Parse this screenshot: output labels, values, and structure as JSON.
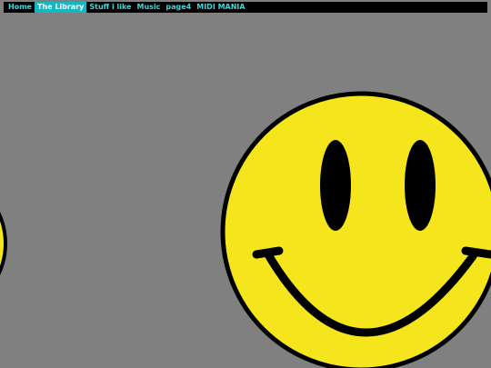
{
  "nav": {
    "items": [
      {
        "label": "Home"
      },
      {
        "label": "The Library",
        "active": true
      },
      {
        "label": "Stuff i like"
      },
      {
        "label": "Music"
      },
      {
        "label": "page4"
      },
      {
        "label": "MIDI MANIA"
      }
    ]
  },
  "colors": {
    "background": "#808080",
    "navbar": "#000000",
    "nav_text": "#3fd6dc",
    "nav_active_bg": "#14b7c4",
    "smiley_face": "#f4e51c",
    "smiley_outline": "#000000"
  },
  "images": [
    {
      "name": "smiley-face",
      "description_icon": "smiley-face-icon"
    }
  ]
}
